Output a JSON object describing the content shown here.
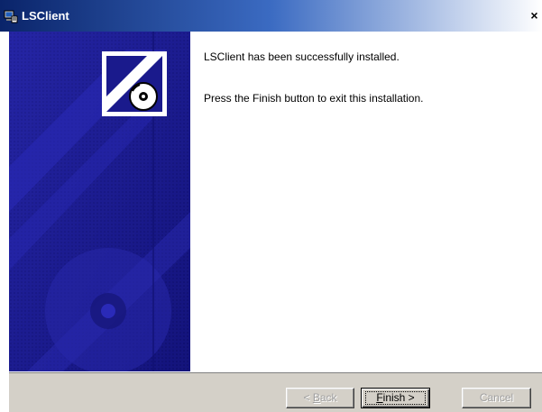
{
  "window": {
    "title": "LSClient",
    "close_glyph": "×",
    "icon": "installer-computer-icon"
  },
  "side_panel": {
    "logo_icon": "cd-install-logo-icon",
    "background_color": "#1a1a8c"
  },
  "main": {
    "message_line1": "LSClient has been successfully installed.",
    "message_line2": "Press the Finish button to exit this installation."
  },
  "buttons": {
    "back_prefix": "< ",
    "back_mnemonic": "B",
    "back_rest": "ack",
    "finish_mnemonic": "F",
    "finish_rest": "inish >",
    "cancel_label": "Cancel"
  },
  "colors": {
    "titlebar_start": "#0a246a",
    "panel_blue": "#1a1a8c",
    "dialog_gray": "#d4d0c8"
  }
}
